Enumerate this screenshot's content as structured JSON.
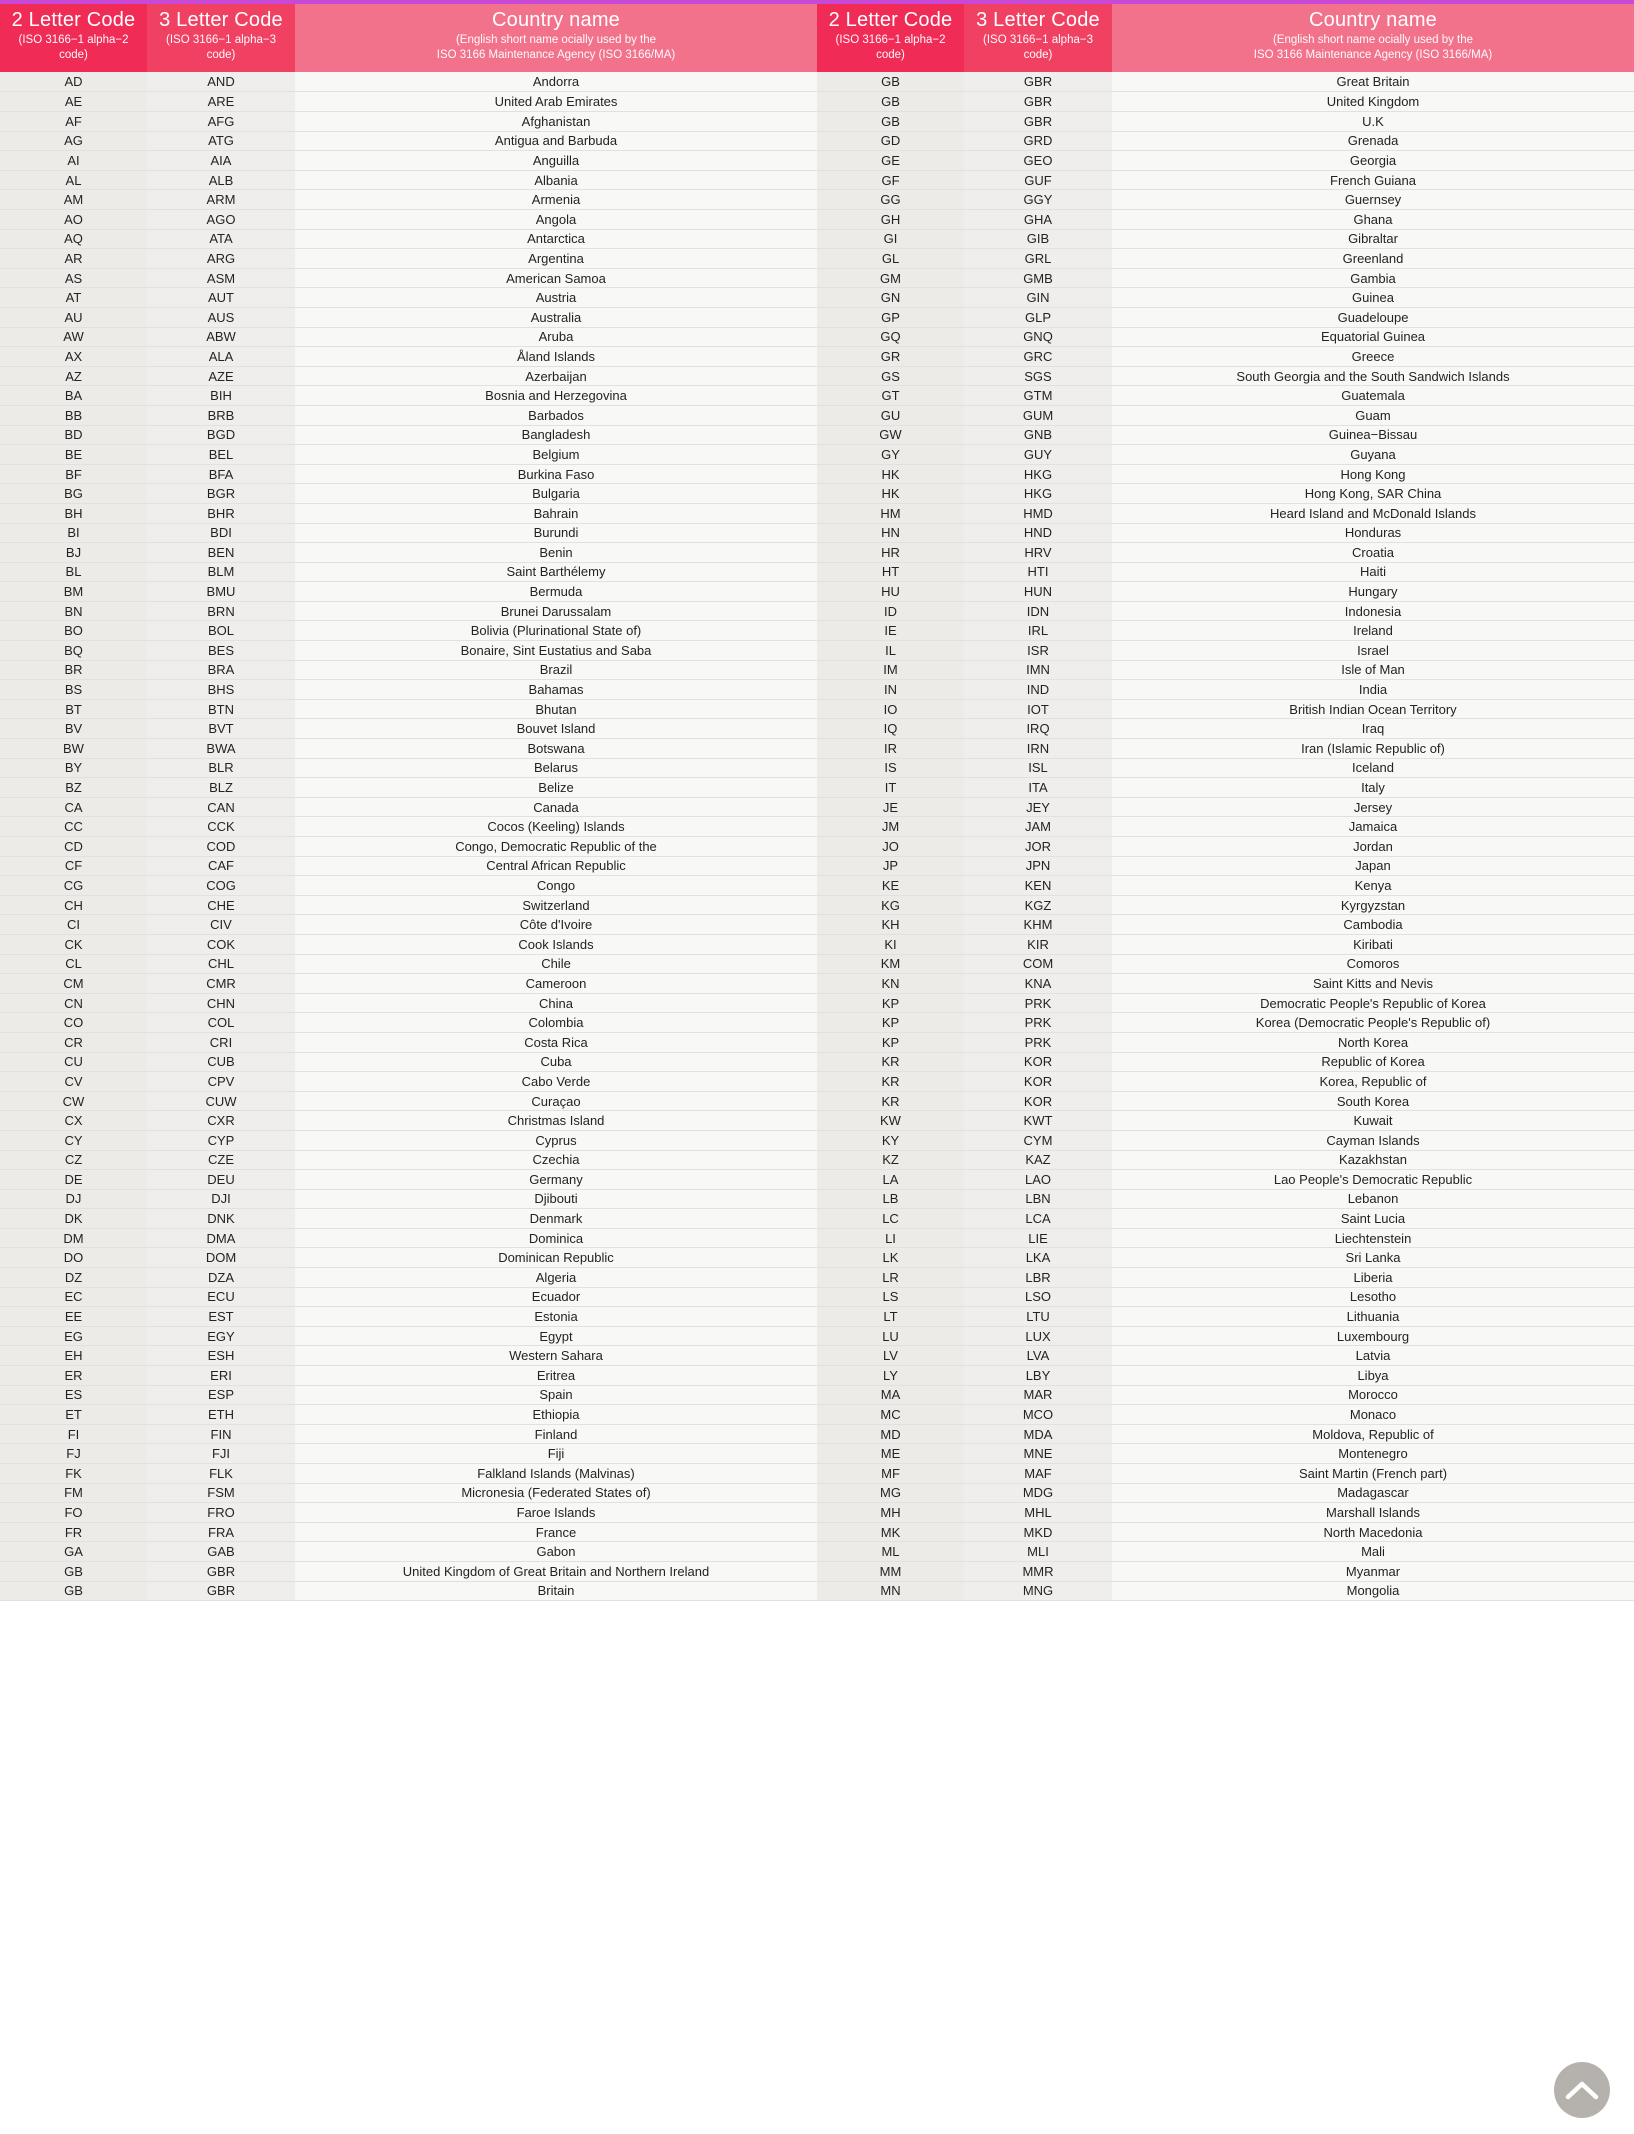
{
  "page": {
    "accent_top_bar": "#c849d8",
    "header_a2_bg": "#ef2b56",
    "header_a3_bg": "#f04163",
    "header_name_bg": "#f2728c",
    "row_a2_bg": "#ecebe8",
    "row_a3_bg": "#efeeec",
    "row_name_bg": "#f8f8f7"
  },
  "header": {
    "col_2letter_title": "2 Letter Code",
    "col_2letter_sub": "(ISO 3166−1 alpha−2 code)",
    "col_3letter_title": "3 Letter Code",
    "col_3letter_sub": "(ISO 3166−1 alpha−3 code)",
    "col_country_title": "Country name",
    "col_country_sub_line1": "(English short name ocially used by the",
    "col_country_sub_line2": "ISO 3166 Maintenance Agency (ISO 3166/MA)"
  },
  "scroll_to_top": {
    "label": "Scroll to top",
    "icon": "chevron-up-icon",
    "color": "#b5b2ae"
  },
  "left_table": [
    [
      "AD",
      "AND",
      "Andorra"
    ],
    [
      "AE",
      "ARE",
      "United Arab Emirates"
    ],
    [
      "AF",
      "AFG",
      "Afghanistan"
    ],
    [
      "AG",
      "ATG",
      "Antigua and Barbuda"
    ],
    [
      "AI",
      "AIA",
      "Anguilla"
    ],
    [
      "AL",
      "ALB",
      "Albania"
    ],
    [
      "AM",
      "ARM",
      "Armenia"
    ],
    [
      "AO",
      "AGO",
      "Angola"
    ],
    [
      "AQ",
      "ATA",
      "Antarctica"
    ],
    [
      "AR",
      "ARG",
      "Argentina"
    ],
    [
      "AS",
      "ASM",
      "American Samoa"
    ],
    [
      "AT",
      "AUT",
      "Austria"
    ],
    [
      "AU",
      "AUS",
      "Australia"
    ],
    [
      "AW",
      "ABW",
      "Aruba"
    ],
    [
      "AX",
      "ALA",
      "Åland Islands"
    ],
    [
      "AZ",
      "AZE",
      "Azerbaijan"
    ],
    [
      "BA",
      "BIH",
      "Bosnia and Herzegovina"
    ],
    [
      "BB",
      "BRB",
      "Barbados"
    ],
    [
      "BD",
      "BGD",
      "Bangladesh"
    ],
    [
      "BE",
      "BEL",
      "Belgium"
    ],
    [
      "BF",
      "BFA",
      "Burkina Faso"
    ],
    [
      "BG",
      "BGR",
      "Bulgaria"
    ],
    [
      "BH",
      "BHR",
      "Bahrain"
    ],
    [
      "BI",
      "BDI",
      "Burundi"
    ],
    [
      "BJ",
      "BEN",
      "Benin"
    ],
    [
      "BL",
      "BLM",
      "Saint Barthélemy"
    ],
    [
      "BM",
      "BMU",
      "Bermuda"
    ],
    [
      "BN",
      "BRN",
      "Brunei Darussalam"
    ],
    [
      "BO",
      "BOL",
      "Bolivia (Plurinational State of)"
    ],
    [
      "BQ",
      "BES",
      "Bonaire, Sint Eustatius and Saba"
    ],
    [
      "BR",
      "BRA",
      "Brazil"
    ],
    [
      "BS",
      "BHS",
      "Bahamas"
    ],
    [
      "BT",
      "BTN",
      "Bhutan"
    ],
    [
      "BV",
      "BVT",
      "Bouvet Island"
    ],
    [
      "BW",
      "BWA",
      "Botswana"
    ],
    [
      "BY",
      "BLR",
      "Belarus"
    ],
    [
      "BZ",
      "BLZ",
      "Belize"
    ],
    [
      "CA",
      "CAN",
      "Canada"
    ],
    [
      "CC",
      "CCK",
      "Cocos (Keeling) Islands"
    ],
    [
      "CD",
      "COD",
      "Congo, Democratic Republic of the"
    ],
    [
      "CF",
      "CAF",
      "Central African Republic"
    ],
    [
      "CG",
      "COG",
      "Congo"
    ],
    [
      "CH",
      "CHE",
      "Switzerland"
    ],
    [
      "CI",
      "CIV",
      "Côte d'Ivoire"
    ],
    [
      "CK",
      "COK",
      "Cook Islands"
    ],
    [
      "CL",
      "CHL",
      "Chile"
    ],
    [
      "CM",
      "CMR",
      "Cameroon"
    ],
    [
      "CN",
      "CHN",
      "China"
    ],
    [
      "CO",
      "COL",
      "Colombia"
    ],
    [
      "CR",
      "CRI",
      "Costa Rica"
    ],
    [
      "CU",
      "CUB",
      "Cuba"
    ],
    [
      "CV",
      "CPV",
      "Cabo Verde"
    ],
    [
      "CW",
      "CUW",
      "Curaçao"
    ],
    [
      "CX",
      "CXR",
      "Christmas Island"
    ],
    [
      "CY",
      "CYP",
      "Cyprus"
    ],
    [
      "CZ",
      "CZE",
      "Czechia"
    ],
    [
      "DE",
      "DEU",
      "Germany"
    ],
    [
      "DJ",
      "DJI",
      "Djibouti"
    ],
    [
      "DK",
      "DNK",
      "Denmark"
    ],
    [
      "DM",
      "DMA",
      "Dominica"
    ],
    [
      "DO",
      "DOM",
      "Dominican Republic"
    ],
    [
      "DZ",
      "DZA",
      "Algeria"
    ],
    [
      "EC",
      "ECU",
      "Ecuador"
    ],
    [
      "EE",
      "EST",
      "Estonia"
    ],
    [
      "EG",
      "EGY",
      "Egypt"
    ],
    [
      "EH",
      "ESH",
      "Western Sahara"
    ],
    [
      "ER",
      "ERI",
      "Eritrea"
    ],
    [
      "ES",
      "ESP",
      "Spain"
    ],
    [
      "ET",
      "ETH",
      "Ethiopia"
    ],
    [
      "FI",
      "FIN",
      "Finland"
    ],
    [
      "FJ",
      "FJI",
      "Fiji"
    ],
    [
      "FK",
      "FLK",
      "Falkland Islands (Malvinas)"
    ],
    [
      "FM",
      "FSM",
      "Micronesia (Federated States of)"
    ],
    [
      "FO",
      "FRO",
      "Faroe Islands"
    ],
    [
      "FR",
      "FRA",
      "France"
    ],
    [
      "GA",
      "GAB",
      "Gabon"
    ],
    [
      "GB",
      "GBR",
      "United Kingdom of Great Britain and Northern Ireland"
    ],
    [
      "GB",
      "GBR",
      "Britain"
    ]
  ],
  "right_table": [
    [
      "GB",
      "GBR",
      "Great Britain"
    ],
    [
      "GB",
      "GBR",
      "United Kingdom"
    ],
    [
      "GB",
      "GBR",
      "U.K"
    ],
    [
      "GD",
      "GRD",
      "Grenada"
    ],
    [
      "GE",
      "GEO",
      "Georgia"
    ],
    [
      "GF",
      "GUF",
      "French Guiana"
    ],
    [
      "GG",
      "GGY",
      "Guernsey"
    ],
    [
      "GH",
      "GHA",
      "Ghana"
    ],
    [
      "GI",
      "GIB",
      "Gibraltar"
    ],
    [
      "GL",
      "GRL",
      "Greenland"
    ],
    [
      "GM",
      "GMB",
      "Gambia"
    ],
    [
      "GN",
      "GIN",
      "Guinea"
    ],
    [
      "GP",
      "GLP",
      "Guadeloupe"
    ],
    [
      "GQ",
      "GNQ",
      "Equatorial Guinea"
    ],
    [
      "GR",
      "GRC",
      "Greece"
    ],
    [
      "GS",
      "SGS",
      "South Georgia and the South Sandwich Islands"
    ],
    [
      "GT",
      "GTM",
      "Guatemala"
    ],
    [
      "GU",
      "GUM",
      "Guam"
    ],
    [
      "GW",
      "GNB",
      "Guinea−Bissau"
    ],
    [
      "GY",
      "GUY",
      "Guyana"
    ],
    [
      "HK",
      "HKG",
      "Hong Kong"
    ],
    [
      "HK",
      "HKG",
      "Hong Kong, SAR China"
    ],
    [
      "HM",
      "HMD",
      "Heard Island and McDonald Islands"
    ],
    [
      "HN",
      "HND",
      "Honduras"
    ],
    [
      "HR",
      "HRV",
      "Croatia"
    ],
    [
      "HT",
      "HTI",
      "Haiti"
    ],
    [
      "HU",
      "HUN",
      "Hungary"
    ],
    [
      "ID",
      "IDN",
      "Indonesia"
    ],
    [
      "IE",
      "IRL",
      "Ireland"
    ],
    [
      "IL",
      "ISR",
      "Israel"
    ],
    [
      "IM",
      "IMN",
      "Isle of Man"
    ],
    [
      "IN",
      "IND",
      "India"
    ],
    [
      "IO",
      "IOT",
      "British Indian Ocean Territory"
    ],
    [
      "IQ",
      "IRQ",
      "Iraq"
    ],
    [
      "IR",
      "IRN",
      "Iran (Islamic Republic of)"
    ],
    [
      "IS",
      "ISL",
      "Iceland"
    ],
    [
      "IT",
      "ITA",
      "Italy"
    ],
    [
      "JE",
      "JEY",
      "Jersey"
    ],
    [
      "JM",
      "JAM",
      "Jamaica"
    ],
    [
      "JO",
      "JOR",
      "Jordan"
    ],
    [
      "JP",
      "JPN",
      "Japan"
    ],
    [
      "KE",
      "KEN",
      "Kenya"
    ],
    [
      "KG",
      "KGZ",
      "Kyrgyzstan"
    ],
    [
      "KH",
      "KHM",
      "Cambodia"
    ],
    [
      "KI",
      "KIR",
      "Kiribati"
    ],
    [
      "KM",
      "COM",
      "Comoros"
    ],
    [
      "KN",
      "KNA",
      "Saint Kitts and Nevis"
    ],
    [
      "KP",
      "PRK",
      "Democratic People's Republic of Korea"
    ],
    [
      "KP",
      "PRK",
      "Korea (Democratic People's Republic of)"
    ],
    [
      "KP",
      "PRK",
      "North Korea"
    ],
    [
      "KR",
      "KOR",
      "Republic of Korea"
    ],
    [
      "KR",
      "KOR",
      "Korea, Republic of"
    ],
    [
      "KR",
      "KOR",
      "South Korea"
    ],
    [
      "KW",
      "KWT",
      "Kuwait"
    ],
    [
      "KY",
      "CYM",
      "Cayman Islands"
    ],
    [
      "KZ",
      "KAZ",
      "Kazakhstan"
    ],
    [
      "LA",
      "LAO",
      "Lao People's Democratic Republic"
    ],
    [
      "LB",
      "LBN",
      "Lebanon"
    ],
    [
      "LC",
      "LCA",
      "Saint Lucia"
    ],
    [
      "LI",
      "LIE",
      "Liechtenstein"
    ],
    [
      "LK",
      "LKA",
      "Sri Lanka"
    ],
    [
      "LR",
      "LBR",
      "Liberia"
    ],
    [
      "LS",
      "LSO",
      "Lesotho"
    ],
    [
      "LT",
      "LTU",
      "Lithuania"
    ],
    [
      "LU",
      "LUX",
      "Luxembourg"
    ],
    [
      "LV",
      "LVA",
      "Latvia"
    ],
    [
      "LY",
      "LBY",
      "Libya"
    ],
    [
      "MA",
      "MAR",
      "Morocco"
    ],
    [
      "MC",
      "MCO",
      "Monaco"
    ],
    [
      "MD",
      "MDA",
      "Moldova, Republic of"
    ],
    [
      "ME",
      "MNE",
      "Montenegro"
    ],
    [
      "MF",
      "MAF",
      "Saint Martin (French part)"
    ],
    [
      "MG",
      "MDG",
      "Madagascar"
    ],
    [
      "MH",
      "MHL",
      "Marshall Islands"
    ],
    [
      "MK",
      "MKD",
      "North Macedonia"
    ],
    [
      "ML",
      "MLI",
      "Mali"
    ],
    [
      "MM",
      "MMR",
      "Myanmar"
    ],
    [
      "MN",
      "MNG",
      "Mongolia"
    ]
  ]
}
